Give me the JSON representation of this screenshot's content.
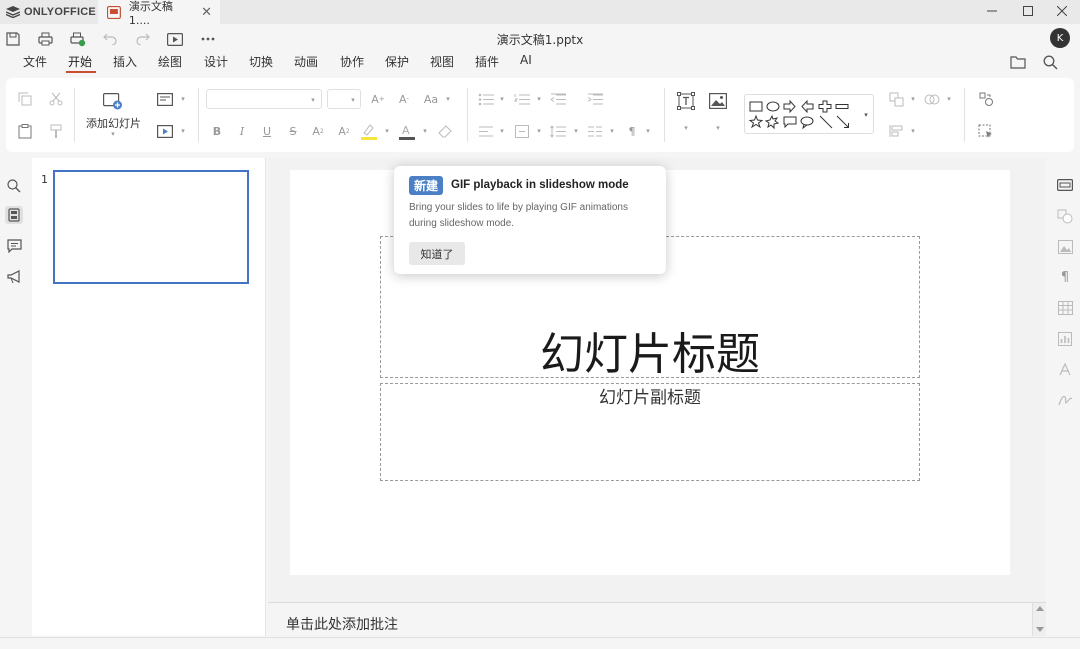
{
  "app": {
    "brand": "ONLYOFFICE"
  },
  "tab": {
    "label": "演示文稿1....",
    "close": "✕"
  },
  "document": {
    "title": "演示文稿1.pptx"
  },
  "user": {
    "initial": "K"
  },
  "menu": {
    "items": [
      "文件",
      "开始",
      "插入",
      "绘图",
      "设计",
      "切换",
      "动画",
      "协作",
      "保护",
      "视图",
      "插件",
      "AI"
    ],
    "active": "开始"
  },
  "ribbon": {
    "add_slide_label": "添加幻灯片"
  },
  "slides": {
    "thumbnail_number": "1"
  },
  "slide": {
    "title": "幻灯片标题",
    "subtitle": "幻灯片副标题"
  },
  "notes": {
    "placeholder": "单击此处添加批注"
  },
  "tip": {
    "badge": "新建",
    "title": "GIF playback in slideshow mode",
    "body": "Bring your slides to life by playing GIF animations during slideshow mode.",
    "button": "知道了"
  },
  "colors": {
    "accent": "#c84d31",
    "selection": "#4573c4",
    "badge": "#4b80c7"
  }
}
